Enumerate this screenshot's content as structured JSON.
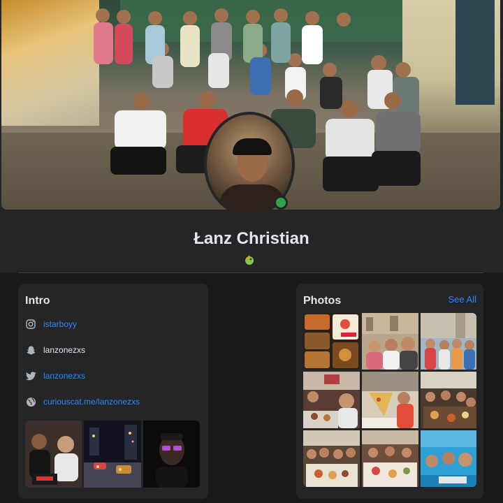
{
  "profile": {
    "name": "Łanz Christian"
  },
  "intro": {
    "title": "Intro",
    "items": [
      {
        "icon": "instagram-icon",
        "text": "istarboyy",
        "link": true
      },
      {
        "icon": "snapchat-icon",
        "text": "lanzonezxs",
        "link": false
      },
      {
        "icon": "twitter-icon",
        "text": "lanzonezxs",
        "link": true
      },
      {
        "icon": "globe-icon",
        "text": "curiouscat.me/lanzonezxs",
        "link": true
      }
    ]
  },
  "photos": {
    "title": "Photos",
    "see_all": "See All"
  },
  "colors": {
    "background": "#18191a",
    "card": "#242526",
    "link": "#2d88ff",
    "online": "#31a24c"
  }
}
